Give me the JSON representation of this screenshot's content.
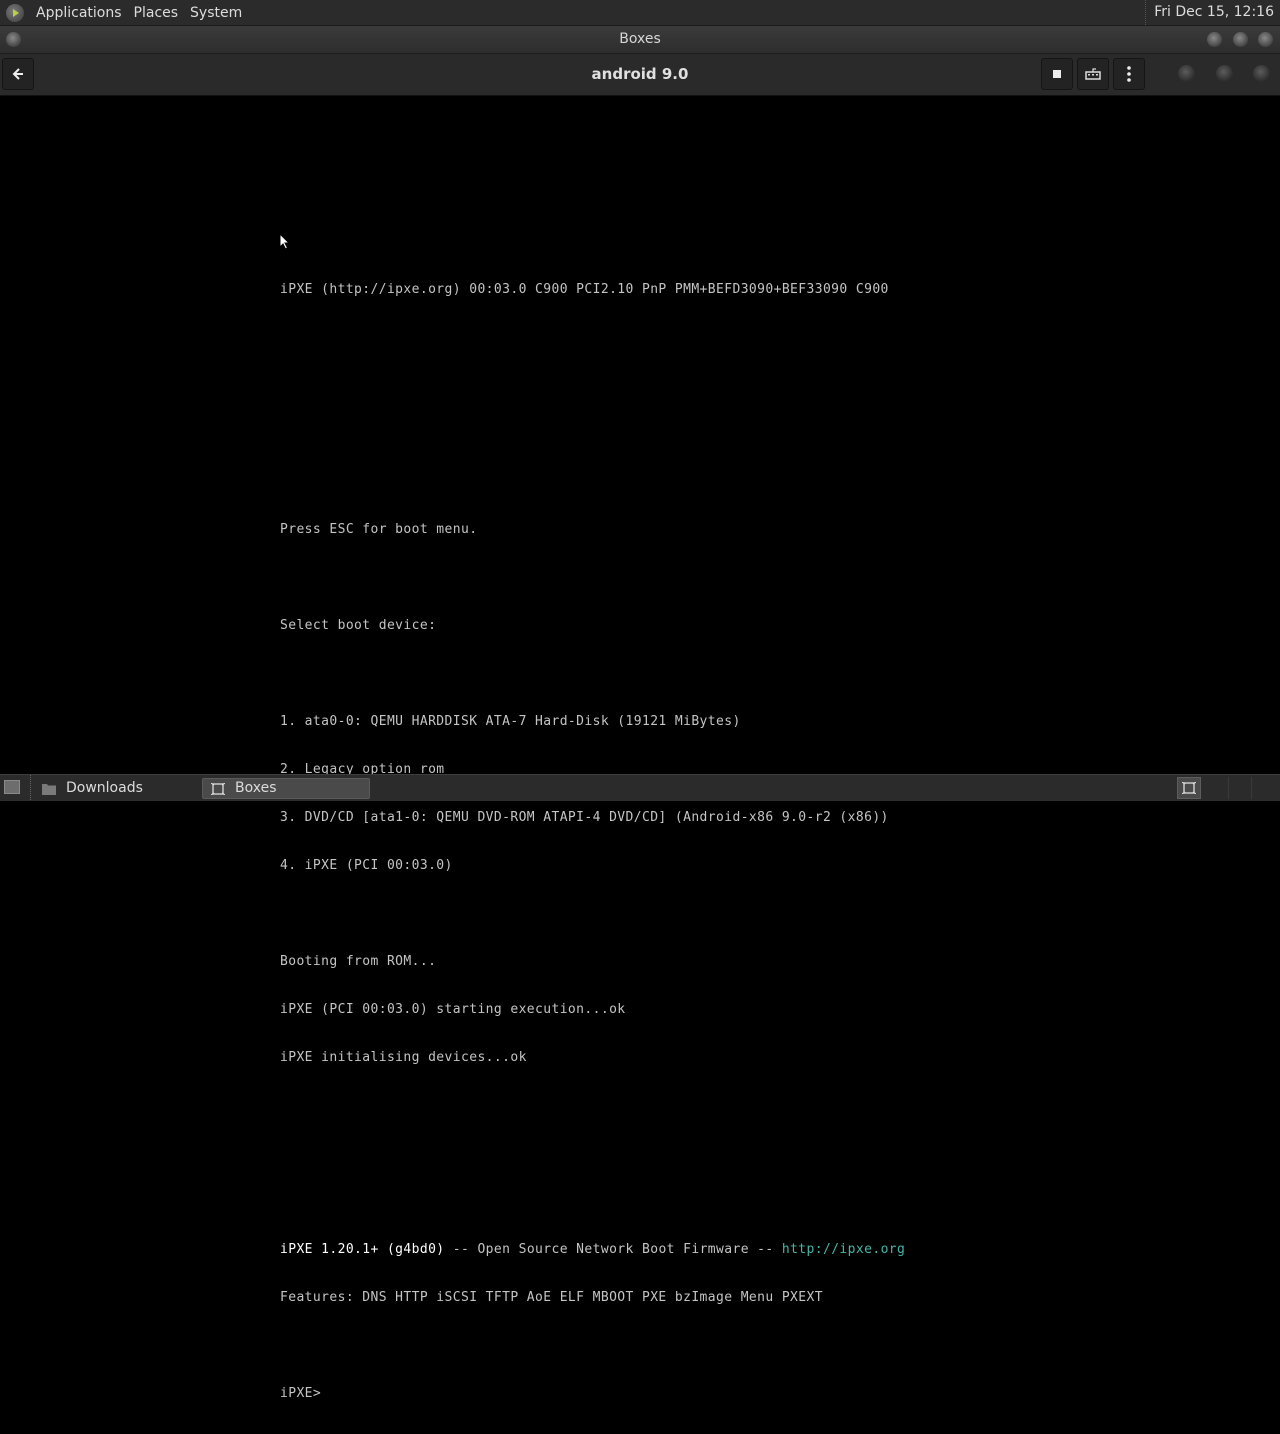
{
  "top_panel": {
    "menus": [
      "Applications",
      "Places",
      "System"
    ],
    "clock": "Fri Dec 15, 12:16"
  },
  "window": {
    "title": "Boxes"
  },
  "headerbar": {
    "title": "android 9.0"
  },
  "console": {
    "lines": [
      "iPXE (http://ipxe.org) 00:03.0 C900 PCI2.10 PnP PMM+BEFD3090+BEF33090 C900",
      "",
      "",
      "",
      "",
      "Press ESC for boot menu.",
      "",
      "Select boot device:",
      "",
      "1. ata0-0: QEMU HARDDISK ATA-7 Hard-Disk (19121 MiBytes)",
      "2. Legacy option rom",
      "3. DVD/CD [ata1-0: QEMU DVD-ROM ATAPI-4 DVD/CD] (Android-x86 9.0-r2 (x86))",
      "4. iPXE (PCI 00:03.0)",
      "",
      "Booting from ROM...",
      "iPXE (PCI 00:03.0) starting execution...ok",
      "iPXE initialising devices...ok",
      "",
      "",
      "",
      "",
      "Features: DNS HTTP iSCSI TFTP AoE ELF MBOOT PXE bzImage Menu PXEXT",
      "",
      "iPXE>"
    ],
    "banner": {
      "version": "iPXE 1.20.1+ (g4bd0)",
      "middle": " -- Open Source Network Boot Firmware -- ",
      "url": "http://ipxe.org"
    }
  },
  "taskbar": {
    "items": [
      "Downloads",
      "Boxes"
    ]
  },
  "colors": {
    "panel": "#2b2b2b",
    "console_text": "#c4c4c4",
    "console_link": "#3fb8a8"
  }
}
